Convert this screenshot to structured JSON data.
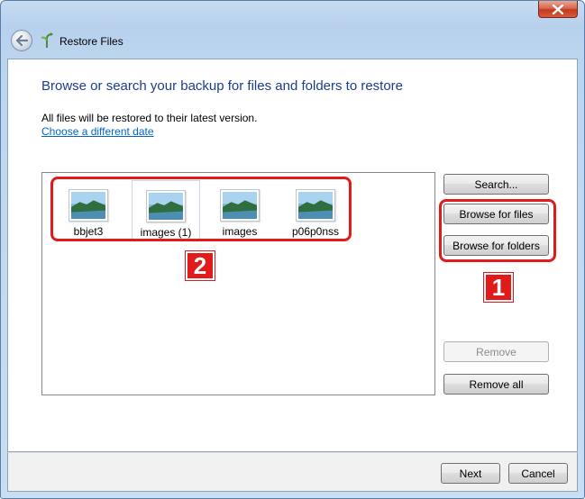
{
  "window": {
    "title": "Restore Files"
  },
  "main": {
    "heading": "Browse or search your backup for files and folders to restore",
    "subtext": "All files will be restored to their latest version.",
    "link": "Choose a different date"
  },
  "files": [
    {
      "label": "bbjet3",
      "selected": false
    },
    {
      "label": "images (1)",
      "selected": true
    },
    {
      "label": "images",
      "selected": false
    },
    {
      "label": "p06p0nss",
      "selected": false
    }
  ],
  "buttons": {
    "search": "Search...",
    "browse_files": "Browse for files",
    "browse_folders": "Browse for folders",
    "remove": "Remove",
    "remove_all": "Remove all",
    "next": "Next",
    "cancel": "Cancel"
  },
  "annotations": {
    "badge1": "1",
    "badge2": "2",
    "color": "#e01b1b"
  },
  "icons": {
    "close": "close-icon",
    "back": "back-arrow-icon",
    "app": "restore-files-icon",
    "thumbnail": "image-thumbnail-icon"
  }
}
